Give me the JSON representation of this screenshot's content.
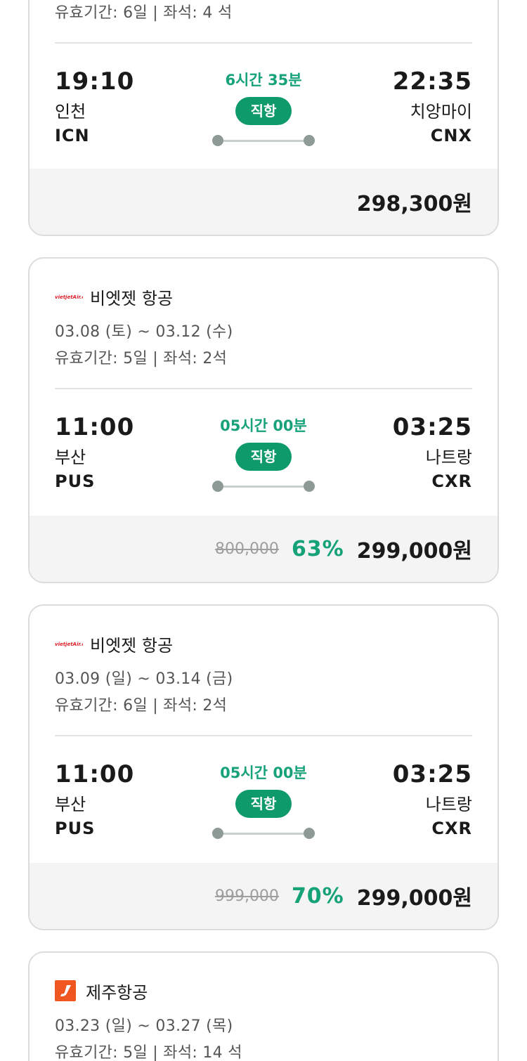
{
  "cards": [
    {
      "validity": "유효기간: 6일 | 좌석: 4 석",
      "departure": {
        "time": "19:10",
        "city": "인천",
        "code": "ICN"
      },
      "arrival": {
        "time": "22:35",
        "city": "치앙마이",
        "code": "CNX"
      },
      "duration": "6시간 35분",
      "flight_type": "직항",
      "price": {
        "final": "298,300원"
      }
    },
    {
      "airline": {
        "name": "비엣젯 항공",
        "logo_icon": "vietjet-logo-icon"
      },
      "dates": "03.08 (토) ~ 03.12 (수)",
      "validity": "유효기간: 5일 | 좌석: 2석",
      "departure": {
        "time": "11:00",
        "city": "부산",
        "code": "PUS"
      },
      "arrival": {
        "time": "03:25",
        "city": "나트랑",
        "code": "CXR"
      },
      "duration": "05시간 00분",
      "flight_type": "직항",
      "price": {
        "original": "800,000",
        "discount": "63%",
        "final": "299,000원"
      }
    },
    {
      "airline": {
        "name": "비엣젯 항공",
        "logo_icon": "vietjet-logo-icon"
      },
      "dates": "03.09 (일) ~ 03.14 (금)",
      "validity": "유효기간: 6일 | 좌석: 2석",
      "departure": {
        "time": "11:00",
        "city": "부산",
        "code": "PUS"
      },
      "arrival": {
        "time": "03:25",
        "city": "나트랑",
        "code": "CXR"
      },
      "duration": "05시간 00분",
      "flight_type": "직항",
      "price": {
        "original": "999,000",
        "discount": "70%",
        "final": "299,000원"
      }
    },
    {
      "airline": {
        "name": "제주항공",
        "logo_icon": "jejuair-logo-icon"
      },
      "dates": "03.23 (일) ~ 03.27 (목)",
      "validity": "유효기간: 5일 | 좌석: 14 석"
    }
  ],
  "colors": {
    "accent_green": "#0f9a6b",
    "duration_green": "#17a27a",
    "discount_green": "#14a276",
    "vietjet_red": "#e0202a",
    "jeju_orange": "#f0561f",
    "price_bar_bg": "#f4f4f4"
  }
}
